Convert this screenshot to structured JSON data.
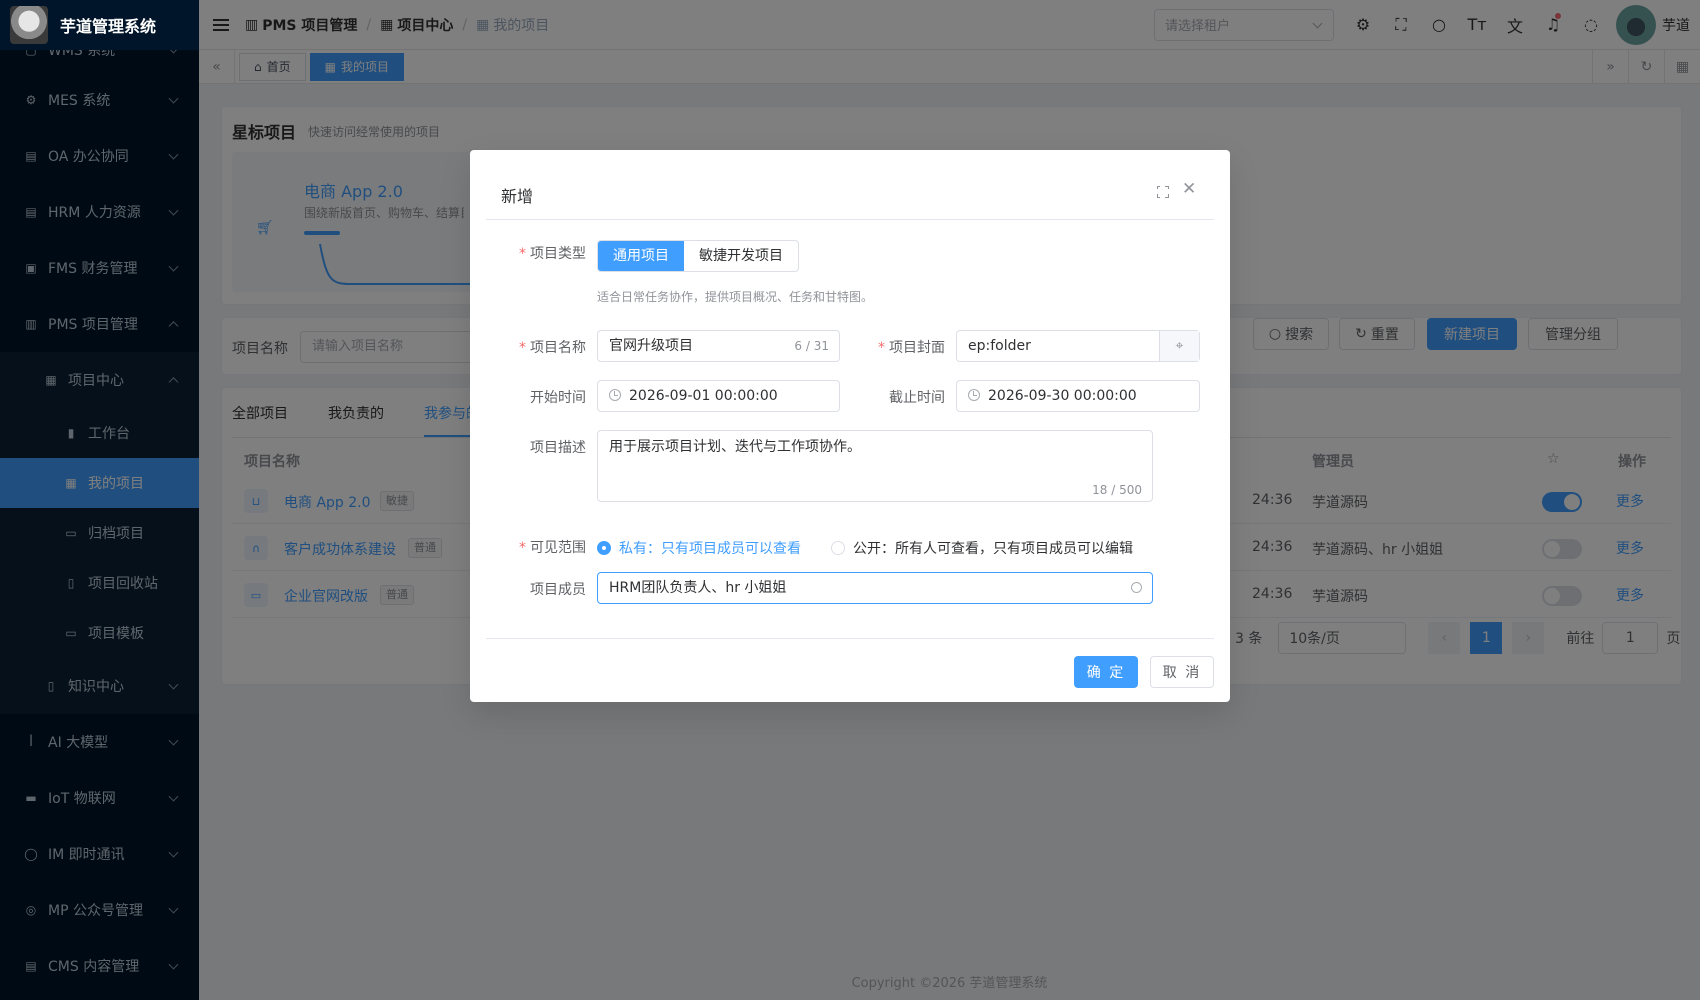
{
  "app": {
    "title": "芋道管理系统"
  },
  "sidebar": {
    "partial_item": "WMS 系统",
    "items": [
      {
        "label": "MES 系统",
        "icon": "cpu-icon"
      },
      {
        "label": "OA 办公协同",
        "icon": "building-icon"
      },
      {
        "label": "HRM 人力资源",
        "icon": "building-icon"
      },
      {
        "label": "FMS 财务管理",
        "icon": "money-icon"
      },
      {
        "label": "PMS 项目管理",
        "icon": "chart-icon"
      }
    ],
    "pms_children": {
      "project_center": "项目中心",
      "children": [
        "工作台",
        "我的项目",
        "归档项目",
        "项目回收站",
        "项目模板"
      ],
      "knowledge": "知识中心"
    },
    "bottom_items": [
      {
        "label": "AI 大模型"
      },
      {
        "label": "IoT 物联网"
      },
      {
        "label": "IM 即时通讯"
      },
      {
        "label": "MP 公众号管理"
      },
      {
        "label": "CMS 内容管理"
      }
    ]
  },
  "header": {
    "breadcrumb": [
      "PMS 项目管理",
      "项目中心",
      "我的项目"
    ],
    "tenant_placeholder": "请选择租户",
    "username": "芋道"
  },
  "tags": {
    "home": "首页",
    "current": "我的项目"
  },
  "star": {
    "title": "星标项目",
    "subtitle": "快速访问经常使用的项目",
    "card_name": "电商 App 2.0",
    "card_desc": "围绕新版首页、购物车、结算目"
  },
  "search": {
    "label": "项目名称",
    "placeholder": "请输入项目名称",
    "search_btn": "搜索",
    "reset_btn": "重置",
    "new_btn": "新建项目",
    "group_btn": "管理分组"
  },
  "table": {
    "tabs": [
      "全部项目",
      "我负责的",
      "我参与的"
    ],
    "headers": {
      "name": "项目名称",
      "manager": "管理员",
      "action": "操作"
    },
    "rows": [
      {
        "name": "电商 App 2.0",
        "badge": "敏捷",
        "time": "24:36",
        "manager": "芋道源码",
        "starred": true,
        "more": "更多"
      },
      {
        "name": "客户成功体系建设",
        "badge": "普通",
        "time": "24:36",
        "manager": "芋道源码、hr 小姐姐",
        "starred": false,
        "more": "更多"
      },
      {
        "name": "企业官网改版",
        "badge": "普通",
        "time": "24:36",
        "manager": "芋道源码",
        "starred": false,
        "more": "更多"
      }
    ],
    "pager": {
      "total": "3 条",
      "size": "10条/页",
      "page": "1",
      "goto": "前往",
      "goto_value": "1",
      "unit": "页"
    }
  },
  "footer": "Copyright ©2026 芋道管理系统",
  "dialog": {
    "title": "新增",
    "type_label": "项目类型",
    "type_options": [
      "通用项目",
      "敏捷开发项目"
    ],
    "type_hint": "适合日常任务协作，提供项目概况、任务和甘特图。",
    "name_label": "项目名称",
    "name_value": "官网升级项目",
    "name_count": "6 / 31",
    "cover_label": "项目封面",
    "cover_value": "ep:folder",
    "start_label": "开始时间",
    "start_value": "2026-09-01 00:00:00",
    "end_label": "截止时间",
    "end_value": "2026-09-30 00:00:00",
    "desc_label": "项目描述",
    "desc_value": "用于展示项目计划、迭代与工作项协作。",
    "desc_count": "18 / 500",
    "scope_label": "可见范围",
    "scope_private": "私有：只有项目成员可以查看",
    "scope_public": "公开：所有人可查看，只有项目成员可以编辑",
    "member_label": "项目成员",
    "member_value": "HRM团队负责人、hr 小姐姐",
    "ok_btn": "确 定",
    "cancel_btn": "取 消"
  }
}
